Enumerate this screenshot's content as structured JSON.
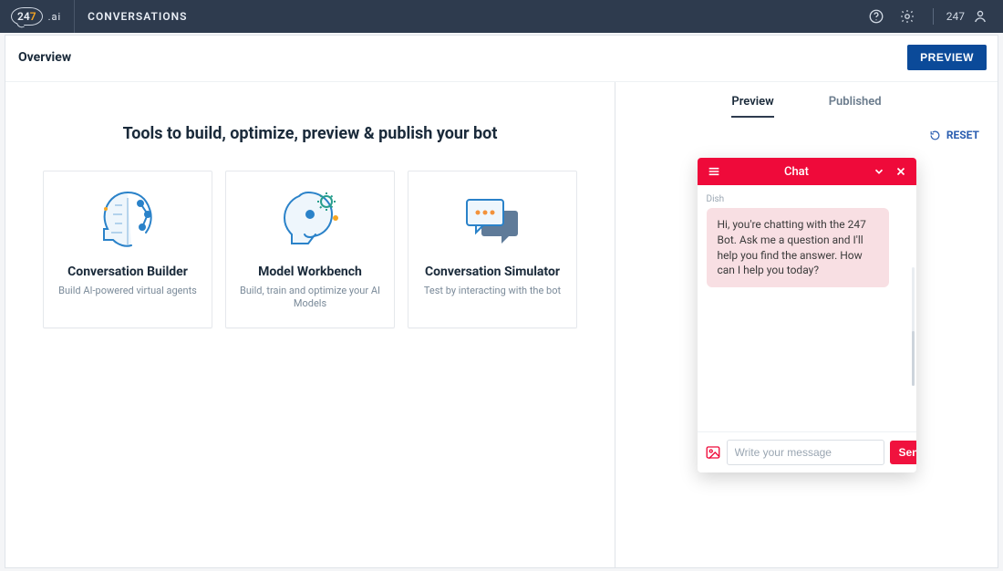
{
  "topbar": {
    "logo_24": "24",
    "logo_7": "7",
    "logo_suffix": ".ai",
    "app_title": "CONVERSATIONS",
    "user_label": "247"
  },
  "page": {
    "title": "Overview",
    "preview_button": "PREVIEW"
  },
  "hero": "Tools to build, optimize, preview & publish your bot",
  "cards": [
    {
      "title": "Conversation Builder",
      "desc": "Build AI-powered virtual agents"
    },
    {
      "title": "Model Workbench",
      "desc": "Build, train and optimize your AI Models"
    },
    {
      "title": "Conversation Simulator",
      "desc": "Test by interacting with the bot"
    }
  ],
  "preview_panel": {
    "tabs": {
      "preview": "Preview",
      "published": "Published",
      "active": "preview"
    },
    "reset_label": "RESET"
  },
  "chat": {
    "header_title": "Chat",
    "bot_name": "Dish",
    "welcome_message": "Hi, you're chatting with the 247 Bot. Ask me a question and I'll help you find the answer. How can I help you today?",
    "input_placeholder": "Write your message",
    "send_label": "Send"
  },
  "colors": {
    "topbar": "#2e3b4e",
    "primary_button": "#0b4a99",
    "chat_accent": "#ef0a3a",
    "bubble_bg": "#f8dfe3"
  }
}
